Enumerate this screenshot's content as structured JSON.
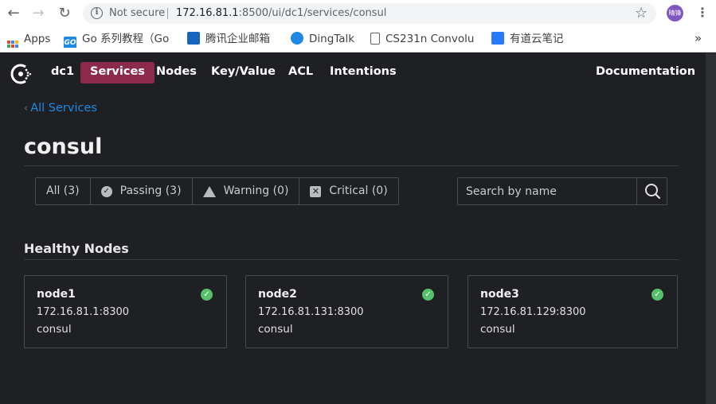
{
  "browser": {
    "not_secure": "Not secure",
    "url_host": "172.16.81.1",
    "url_rest": ":8500/ui/dc1/services/consul",
    "profile_initials": "晴锋",
    "bookmarks": [
      {
        "label": "Apps",
        "icon": "apps-grid-icon"
      },
      {
        "label": "Go 系列教程（Go",
        "icon": "go-icon",
        "color": "#1e88e5"
      },
      {
        "label": "腾讯企业邮箱",
        "icon": "tencent-mail-icon",
        "color": "#1565c0"
      },
      {
        "label": "DingTalk",
        "icon": "dingtalk-icon",
        "color": "#1e88e5"
      },
      {
        "label": "CS231n Convolu",
        "icon": "page-icon"
      },
      {
        "label": "有道云笔记",
        "icon": "youdao-note-icon",
        "color": "#2979ff"
      }
    ]
  },
  "nav": {
    "datacenter": "dc1",
    "items": [
      "Services",
      "Nodes",
      "Key/Value",
      "ACL",
      "Intentions"
    ],
    "active": "Services",
    "documentation": "Documentation"
  },
  "back_link": "All Services",
  "title": "consul",
  "filters": {
    "all": "All (3)",
    "passing": "Passing (3)",
    "warning": "Warning (0)",
    "critical": "Critical (0)"
  },
  "search": {
    "placeholder": "Search by name"
  },
  "section": {
    "title": "Healthy Nodes"
  },
  "nodes": [
    {
      "name": "node1",
      "address": "172.16.81.1:8300",
      "service": "consul"
    },
    {
      "name": "node2",
      "address": "172.16.81.131:8300",
      "service": "consul"
    },
    {
      "name": "node3",
      "address": "172.16.81.129:8300",
      "service": "consul"
    }
  ],
  "colors": {
    "active_nav": "#8c2a4b",
    "link": "#1b8be6",
    "passing": "#57c06a",
    "background": "#1f2024"
  }
}
